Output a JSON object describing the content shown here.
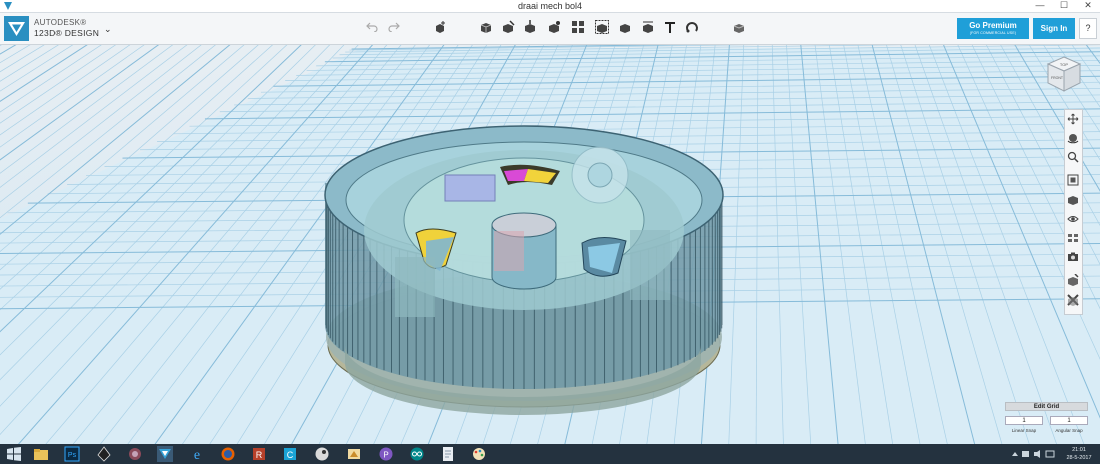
{
  "window": {
    "title": "draai mech bol4",
    "minimize": "—",
    "maximize": "☐",
    "close": "✕"
  },
  "brand": {
    "line1": "AUTODESK®",
    "line2": "123D® DESIGN",
    "menu_chevron": "⌄"
  },
  "toolbar": {
    "undo_icon": "undo-icon",
    "redo_icon": "redo-icon",
    "tools": [
      "transform-icon",
      "primitives-icon",
      "sketch-icon",
      "construct-icon",
      "modify-icon",
      "pattern-icon",
      "grouping-icon",
      "combine-icon",
      "measure-icon",
      "text-icon",
      "snap-icon",
      "material-icon"
    ],
    "premium_label": "Go Premium",
    "premium_sub": "(FOR COMMERCIAL USE)",
    "signin_label": "Sign In",
    "help_label": "?"
  },
  "viewcube": {
    "top": "TOP",
    "front": "FRONT"
  },
  "navbar": {
    "tools": [
      "pan-icon",
      "orbit-icon",
      "zoom-icon",
      "fit-icon",
      "view-mode-icon",
      "visibility-icon",
      "views-icon",
      "screenshot-icon",
      "materials-outlines-icon",
      "settings-icon"
    ]
  },
  "edit_grid": {
    "button": "Edit Grid",
    "linear_value": "1",
    "angular_value": "1",
    "linear_label": "Linear Snap",
    "angular_label": "Angular Snap"
  },
  "taskbar": {
    "apps": [
      "start-icon",
      "file-explorer-icon",
      "photoshop-icon",
      "inkscape-icon",
      "app-icon",
      "123d-design-icon",
      "internet-explorer-icon",
      "firefox-icon",
      "app-r-icon",
      "ccleaner-icon",
      "steam-icon",
      "app-icon-2",
      "purple-app-icon",
      "arduino-icon",
      "document-icon",
      "paint-icon"
    ],
    "time": "21:01",
    "date": "28-5-2017"
  },
  "colors": {
    "accent": "#1f9fd8",
    "grid_line": "#9cc7e0",
    "model_teal": "#7fb6c2",
    "taskbar": "#24323f"
  }
}
